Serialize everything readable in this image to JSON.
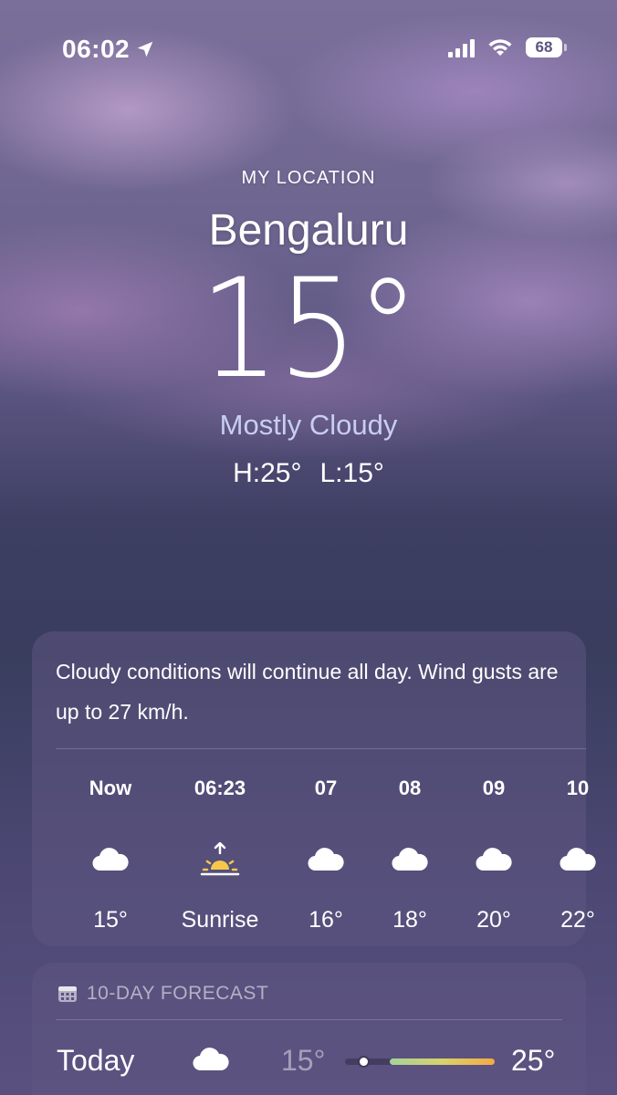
{
  "status_bar": {
    "time": "06:02",
    "battery": "68",
    "icons": [
      "location-arrow-icon",
      "cellular-signal-icon",
      "wifi-icon",
      "battery-icon"
    ]
  },
  "header": {
    "label": "MY LOCATION",
    "city": "Bengaluru",
    "temperature": "15°",
    "condition": "Mostly Cloudy",
    "high": "H:25°",
    "low": "L:15°"
  },
  "hourly": {
    "summary": "Cloudy conditions will continue all day. Wind gusts are up to 27 km/h.",
    "items": [
      {
        "time": "Now",
        "icon": "cloud-icon",
        "value": "15°"
      },
      {
        "time": "06:23",
        "icon": "sunrise-icon",
        "value": "Sunrise"
      },
      {
        "time": "07",
        "icon": "cloud-icon",
        "value": "16°"
      },
      {
        "time": "08",
        "icon": "cloud-icon",
        "value": "18°"
      },
      {
        "time": "09",
        "icon": "cloud-icon",
        "value": "20°"
      },
      {
        "time": "10",
        "icon": "cloud-icon",
        "value": "22°"
      }
    ]
  },
  "forecast": {
    "title": "10-DAY FORECAST",
    "header_icon": "calendar-icon",
    "days": [
      {
        "day": "Today",
        "icon": "cloud-icon",
        "low": "15°",
        "high": "25°",
        "current_position": 0.12,
        "range_start": 0.3,
        "range_end": 1.0
      }
    ]
  },
  "colors": {
    "condition_text": "#c9cdf3",
    "sun_yellow": "#f5c84a",
    "range_gradient": [
      "#a6d39a",
      "#d8d26a",
      "#f4a946"
    ]
  }
}
